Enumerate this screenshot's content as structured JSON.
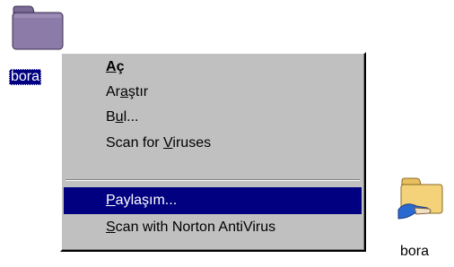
{
  "desktop": {
    "selected_icon": {
      "icon": "folder-icon",
      "label": "bora"
    },
    "shared_icon": {
      "icon": "shared-folder-icon",
      "label": "bora"
    }
  },
  "context_menu": {
    "items": [
      {
        "label": "Aç",
        "underline_index": 0,
        "default": true,
        "highlighted": false
      },
      {
        "label": "Araştır",
        "underline_index": 2,
        "default": false,
        "highlighted": false
      },
      {
        "label": "Bul...",
        "underline_index": 1,
        "default": false,
        "highlighted": false
      },
      {
        "label": "Scan for Viruses",
        "underline_index": 9,
        "default": false,
        "highlighted": false
      },
      {
        "label": "Paylaşım...",
        "underline_index": 0,
        "default": false,
        "highlighted": true
      },
      {
        "label": "Scan with Norton AntiVirus",
        "underline_index": 0,
        "default": false,
        "highlighted": false
      }
    ]
  },
  "colors": {
    "menu_background": "#c0c0c0",
    "highlight": "#000080",
    "folder_fill": "#8c7aa8",
    "shared_folder_fill": "#f4d27a"
  }
}
